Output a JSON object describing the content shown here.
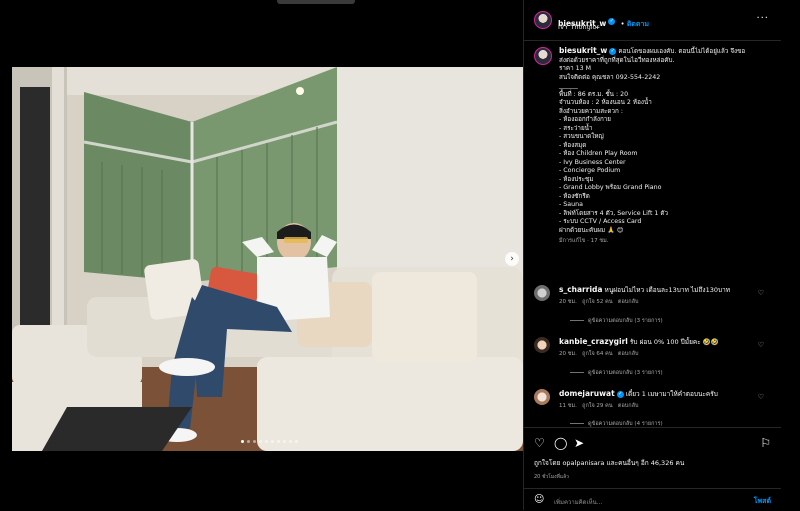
{
  "post": {
    "username": "biesukrit_w",
    "follow_label": "ติดตาม",
    "location": "IVY Thonglor",
    "caption": {
      "lead": "คอนโดของผมเองคับ. ตอนนี้ไม่ได้อยู่แล้ว จึงขอ",
      "lines": [
        "ส่งต่อด้วยราคาที่ถูกที่สุดในไอวี่ทองหล่อคับ.",
        "ราคา 13 M",
        "สนใจติดต่อ คุณชลา 092-554-2242",
        "______",
        "พื้นที่ : 86 ตร.ม. ชั้น : 20",
        "จำนวนห้อง : 2 ห้องนอน 2 ห้องน้ำ",
        "สิ่งอำนวยความสะดวก :",
        "- ห้องออกกำลังกาย",
        "- สระว่ายน้ำ",
        "- สวนขนาดใหญ่",
        "- ห้องสมุด",
        "- ห้อง Children Play Room",
        "- Ivy Business Center",
        "- Concierge Podium",
        "- ห้องประชุม",
        "- Grand Lobby พร้อม Grand Piano",
        "- ห้องซักรีด",
        "- Sauna",
        "- ลิฟท์โดยสาร 4 ตัว, Service Lift 1 ตัว",
        "- ระบบ CCTV / Access Card",
        "",
        "ฝากด้วยนะคับผม 🙏 😊"
      ],
      "meta": "มีการแก้ไข · 17 ชม."
    },
    "comments": [
      {
        "user": "s_charrida",
        "text": "หนูผ่อนไม่ไหว เดือนละ13บาท ไม่ถึง130บาท",
        "time": "20 ชม.",
        "likes": "ถูกใจ 52 คน",
        "reply": "ตอบกลับ",
        "view": "ดูข้อความตอบกลับ (3 รายการ)"
      },
      {
        "user": "kanbie_crazygirl",
        "text": "รับ ผ่อน 0% 100 ปีมั้ยคะ 🤣🤣",
        "time": "20 ชม.",
        "likes": "ถูกใจ 64 คน",
        "reply": "ตอบกลับ",
        "view": "ดูข้อความตอบกลับ (3 รายการ)"
      },
      {
        "user": "domejaruwat",
        "text": "เดี๋ยว 1 เมษามาให้คำตอบนะครับ",
        "time": "11 ชม.",
        "likes": "ถูกใจ 29 คน",
        "reply": "ตอบกลับ",
        "view": "ดูข้อความตอบกลับ (4 รายการ)"
      }
    ],
    "likes_text": "ถูกใจโดย opalpanisara และคนอื่นๆ อีก 46,326 คน",
    "when": "20 ชั่วโมงที่แล้ว",
    "add_comment_placeholder": "เพิ่มความคิดเห็น...",
    "post_label": "โพสต์",
    "icons": [
      "heart-icon",
      "comment-icon",
      "share-icon",
      "bookmark-icon",
      "emoji-icon",
      "more-icon",
      "chevron-right-icon"
    ],
    "colors": {
      "accent": "#0095f6",
      "background": "#000000"
    }
  }
}
